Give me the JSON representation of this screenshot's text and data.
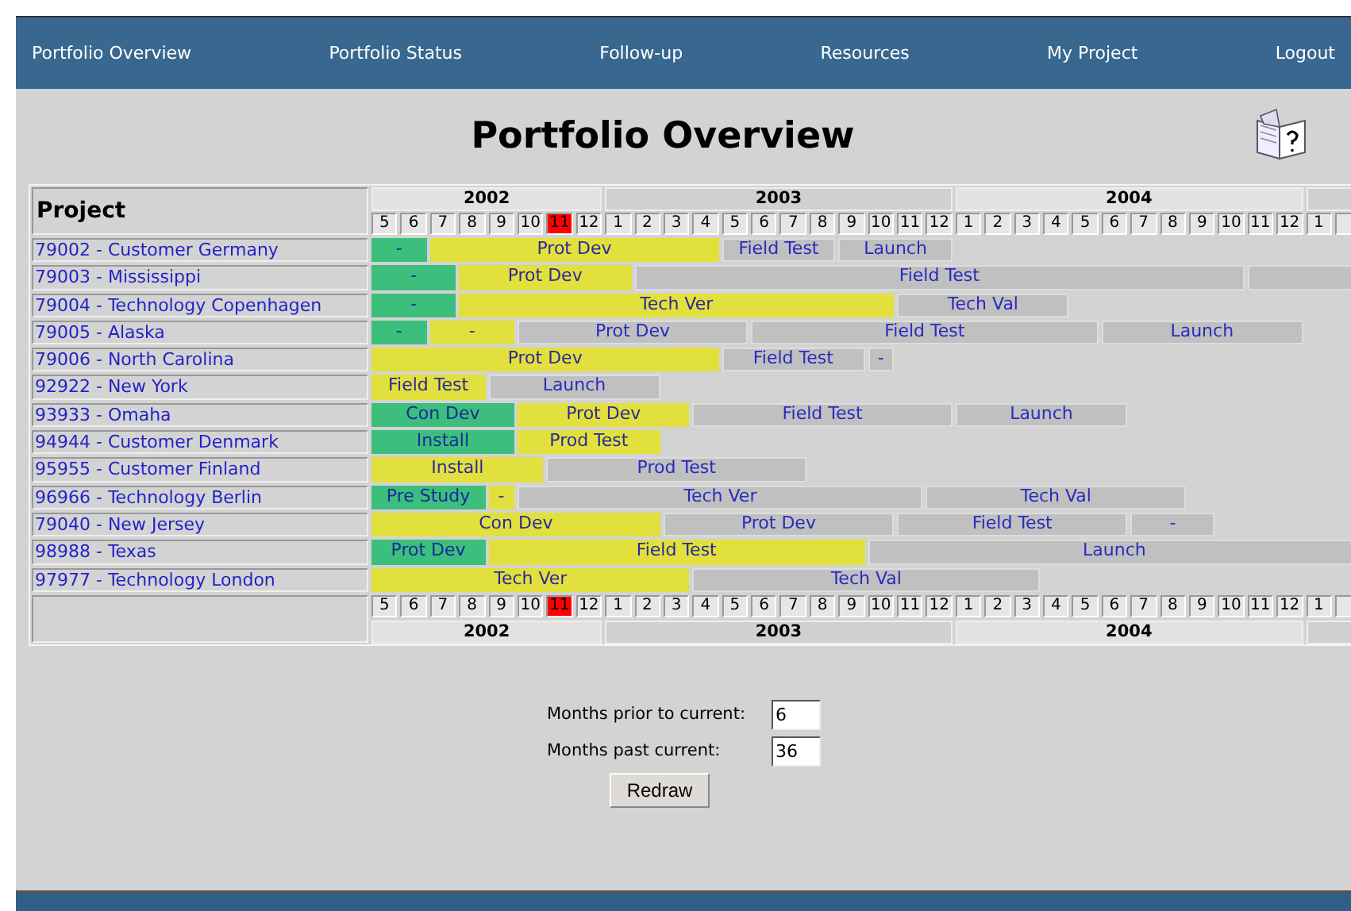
{
  "nav": [
    {
      "label": "Portfolio Overview"
    },
    {
      "label": "Portfolio Status"
    },
    {
      "label": "Follow-up"
    },
    {
      "label": "Resources"
    },
    {
      "label": "My Project"
    },
    {
      "label": "Logout"
    }
  ],
  "title": "Portfolio Overview",
  "table": {
    "project_header": "Project",
    "header_years": [
      {
        "label": "2002",
        "months": [
          {
            "label": "5",
            "current": false
          },
          {
            "label": "6",
            "current": false
          },
          {
            "label": "7",
            "current": false
          },
          {
            "label": "8",
            "current": false
          },
          {
            "label": "9",
            "current": false
          },
          {
            "label": "10",
            "current": false
          },
          {
            "label": "11",
            "current": true
          },
          {
            "label": "12",
            "current": false
          }
        ]
      },
      {
        "label": "2003",
        "months": [
          {
            "label": "1",
            "current": false
          },
          {
            "label": "2",
            "current": false
          },
          {
            "label": "3",
            "current": false
          },
          {
            "label": "4",
            "current": false
          },
          {
            "label": "5",
            "current": false
          },
          {
            "label": "6",
            "current": false
          },
          {
            "label": "7",
            "current": false
          },
          {
            "label": "8",
            "current": false
          },
          {
            "label": "9",
            "current": false
          },
          {
            "label": "10",
            "current": false
          },
          {
            "label": "11",
            "current": false
          },
          {
            "label": "12",
            "current": false
          }
        ]
      },
      {
        "label": "2004",
        "months": [
          {
            "label": "1",
            "current": false
          },
          {
            "label": "2",
            "current": false
          },
          {
            "label": "3",
            "current": false
          },
          {
            "label": "4",
            "current": false
          },
          {
            "label": "5",
            "current": false
          },
          {
            "label": "6",
            "current": false
          },
          {
            "label": "7",
            "current": false
          },
          {
            "label": "8",
            "current": false
          },
          {
            "label": "9",
            "current": false
          },
          {
            "label": "10",
            "current": false
          },
          {
            "label": "11",
            "current": false
          },
          {
            "label": "12",
            "current": false
          }
        ]
      },
      {
        "months": [
          {
            "label": "1",
            "current": false
          }
        ]
      }
    ],
    "projects": [
      {
        "name": "79002 - Customer Germany",
        "phases": [
          {
            "label": "-",
            "kind": "done"
          },
          {
            "label": "Prot Dev",
            "kind": "active"
          },
          {
            "label": "Field Test",
            "kind": "planned"
          },
          {
            "label": "Launch",
            "kind": "planned"
          }
        ]
      },
      {
        "name": "79003 - Mississippi",
        "phases": [
          {
            "label": "-",
            "kind": "done"
          },
          {
            "label": "Prot Dev",
            "kind": "active"
          },
          {
            "label": "Field Test",
            "kind": "planned"
          },
          {
            "kind": "planned"
          }
        ]
      },
      {
        "name": "79004 - Technology Copenhagen",
        "phases": [
          {
            "label": "-",
            "kind": "done"
          },
          {
            "label": "Tech Ver",
            "kind": "active"
          },
          {
            "label": "Tech Val",
            "kind": "planned"
          }
        ]
      },
      {
        "name": "79005 - Alaska",
        "phases": [
          {
            "label": "-",
            "kind": "done"
          },
          {
            "label": "-",
            "kind": "active"
          },
          {
            "label": "Prot Dev",
            "kind": "planned"
          },
          {
            "label": "Field Test",
            "kind": "planned"
          },
          {
            "label": "Launch",
            "kind": "planned"
          }
        ]
      },
      {
        "name": "79006 - North Carolina",
        "phases": [
          {
            "label": "Prot Dev",
            "kind": "active"
          },
          {
            "label": "Field Test",
            "kind": "planned"
          },
          {
            "label": "-",
            "kind": "planned"
          }
        ]
      },
      {
        "name": "92922 - New York",
        "phases": [
          {
            "label": "Field Test",
            "kind": "active"
          },
          {
            "label": "Launch",
            "kind": "planned"
          }
        ]
      },
      {
        "name": "93933 - Omaha",
        "phases": [
          {
            "label": "Con Dev",
            "kind": "done"
          },
          {
            "label": "Prot Dev",
            "kind": "active"
          },
          {
            "label": "Field Test",
            "kind": "planned"
          },
          {
            "label": "Launch",
            "kind": "planned"
          }
        ]
      },
      {
        "name": "94944 - Customer Denmark",
        "phases": [
          {
            "label": "Install",
            "kind": "done"
          },
          {
            "label": "Prod Test",
            "kind": "active"
          }
        ]
      },
      {
        "name": "95955 - Customer Finland",
        "phases": [
          {
            "label": "Install",
            "kind": "active"
          },
          {
            "label": "Prod Test",
            "kind": "planned"
          }
        ]
      },
      {
        "name": "96966 - Technology Berlin",
        "phases": [
          {
            "label": "Pre Study",
            "kind": "done"
          },
          {
            "label": "-",
            "kind": "active"
          },
          {
            "label": "Tech Ver",
            "kind": "planned"
          },
          {
            "label": "Tech Val",
            "kind": "planned"
          }
        ]
      },
      {
        "name": "79040 - New Jersey",
        "phases": [
          {
            "label": "Con Dev",
            "kind": "active"
          },
          {
            "label": "Prot Dev",
            "kind": "planned"
          },
          {
            "label": "Field Test",
            "kind": "planned"
          },
          {
            "label": "-",
            "kind": "planned"
          }
        ]
      },
      {
        "name": "98988 - Texas",
        "phases": [
          {
            "label": "Prot Dev",
            "kind": "done"
          },
          {
            "label": "Field Test",
            "kind": "active"
          },
          {
            "label": "Launch",
            "kind": "planned"
          }
        ]
      },
      {
        "name": "97977 - Technology London",
        "phases": [
          {
            "label": "Tech Ver",
            "kind": "active"
          },
          {
            "label": "Tech Val",
            "kind": "planned"
          }
        ]
      }
    ],
    "footer_years": [
      {
        "label": "2002",
        "months": [
          {
            "label": "5",
            "current": false
          },
          {
            "label": "6",
            "current": false
          },
          {
            "label": "7",
            "current": false
          },
          {
            "label": "8",
            "current": false
          },
          {
            "label": "9",
            "current": false
          },
          {
            "label": "10",
            "current": false
          },
          {
            "label": "11",
            "current": true
          },
          {
            "label": "12",
            "current": false
          }
        ]
      },
      {
        "label": "2003",
        "months": [
          {
            "label": "1",
            "current": false
          },
          {
            "label": "2",
            "current": false
          },
          {
            "label": "3",
            "current": false
          },
          {
            "label": "4",
            "current": false
          },
          {
            "label": "5",
            "current": false
          },
          {
            "label": "6",
            "current": false
          },
          {
            "label": "7",
            "current": false
          },
          {
            "label": "8",
            "current": false
          },
          {
            "label": "9",
            "current": false
          },
          {
            "label": "10",
            "current": false
          },
          {
            "label": "11",
            "current": false
          },
          {
            "label": "12",
            "current": false
          }
        ]
      },
      {
        "label": "2004",
        "months": [
          {
            "label": "1",
            "current": false
          },
          {
            "label": "2",
            "current": false
          },
          {
            "label": "3",
            "current": false
          },
          {
            "label": "4",
            "current": false
          },
          {
            "label": "5",
            "current": false
          },
          {
            "label": "6",
            "current": false
          },
          {
            "label": "7",
            "current": false
          },
          {
            "label": "8",
            "current": false
          },
          {
            "label": "9",
            "current": false
          },
          {
            "label": "10",
            "current": false
          },
          {
            "label": "11",
            "current": false
          },
          {
            "label": "12",
            "current": false
          }
        ]
      },
      {
        "months": [
          {
            "label": "1",
            "current": false
          }
        ]
      }
    ]
  },
  "form": {
    "fields": [
      {
        "label": "Months prior to current:",
        "value": "6"
      },
      {
        "label": "Months past current:",
        "value": "36"
      }
    ],
    "button": "Redraw"
  }
}
